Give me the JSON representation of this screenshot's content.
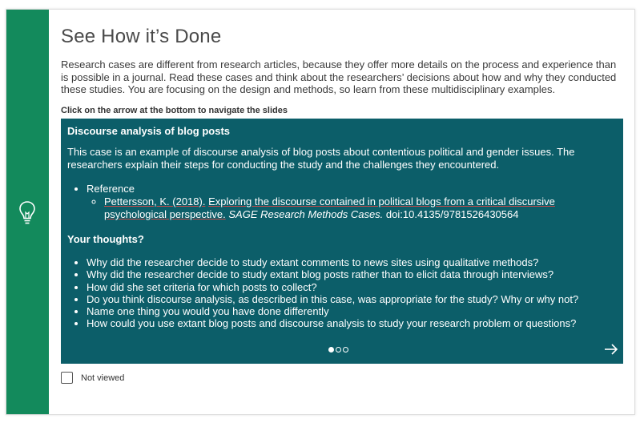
{
  "colors": {
    "side_bar": "#138a5c",
    "slide_background": "#0c5e69",
    "title_text": "#4a4a4a"
  },
  "icons": {
    "side": "lightbulb-icon",
    "next": "arrow-right-icon"
  },
  "page": {
    "title": "See How it’s Done",
    "intro": "Research cases are different from research articles, because they offer more details on the process and experience than is possible in a journal. Read these cases and think about the researchers’ decisions about how and why they conducted these studies. You are focusing on the design and methods, so learn from these multidisciplinary examples.",
    "instruction": "Click on the arrow at the bottom to navigate the slides"
  },
  "slide": {
    "heading": "Discourse analysis of blog posts",
    "description": "This case is an example of discourse analysis of blog posts about contentious political and gender issues. The researchers explain their steps for conducting the study and the challenges they encountered.",
    "reference_label": "Reference",
    "citation": {
      "authors": "Pettersson, K. (2018).",
      "title": "Exploring the discourse contained in political blogs from a critical discursive psychological perspective.",
      "journal": "SAGE Research Methods Cases.",
      "doi": "doi:10.4135/9781526430564"
    },
    "thoughts_heading": "Your thoughts?",
    "questions": [
      "Why did the researcher decide to study extant comments to news sites using qualitative methods?",
      "Why did the researcher decide to study extant blog posts rather than to elicit data through interviews?",
      "How did she set criteria for which posts to collect?",
      "Do you think discourse analysis, as described in this case, was appropriate for the study? Why or why not?",
      "Name one thing you would you have done differently",
      "How could you use extant blog posts and discourse analysis to study your research problem or questions?"
    ],
    "pagination": {
      "current": 1,
      "total": 3
    }
  },
  "status": {
    "viewed_label": "Not viewed",
    "viewed": false
  }
}
